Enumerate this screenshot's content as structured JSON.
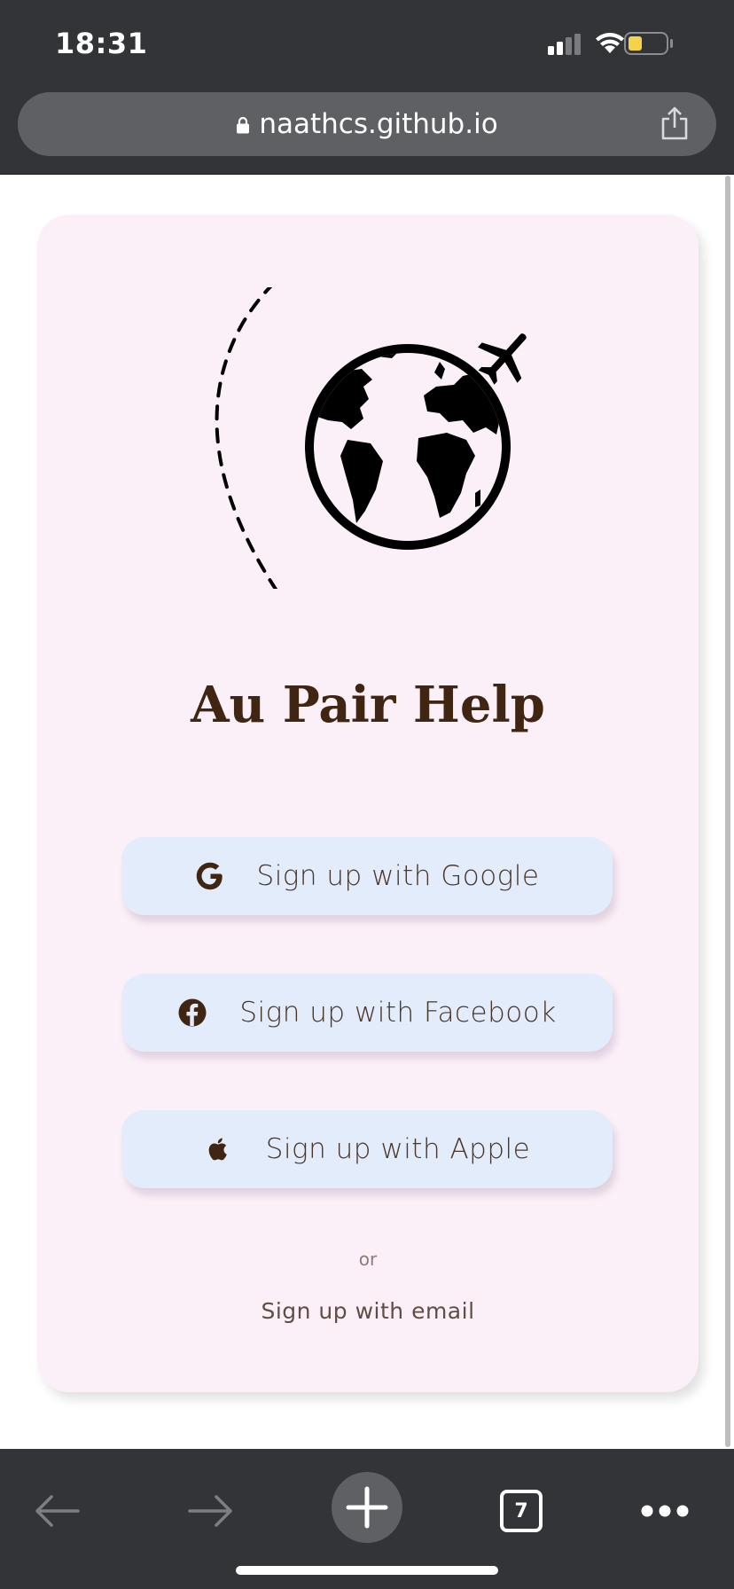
{
  "status_bar": {
    "time": "18:31",
    "signal_icon": "cellular-signal-icon",
    "wifi_icon": "wifi-icon",
    "battery_icon": "battery-icon",
    "battery_color": "#f4d24a"
  },
  "browser": {
    "url": "naathcs.github.io",
    "lock_icon": "lock-icon",
    "share_icon": "share-icon"
  },
  "card": {
    "background": "#fbf0f8",
    "illustration": "globe-with-airplane-icon",
    "title": "Au Pair Help",
    "buttons": [
      {
        "icon": "google-icon",
        "label": "Sign up with Google"
      },
      {
        "icon": "facebook-icon",
        "label": "Sign up with Facebook"
      },
      {
        "icon": "apple-icon",
        "label": "Sign up with Apple"
      }
    ],
    "separator": "or",
    "email_link": "Sign up with email"
  },
  "toolbar": {
    "back_icon": "back-arrow-icon",
    "forward_icon": "forward-arrow-icon",
    "new_tab_icon": "plus-icon",
    "tab_count": "7",
    "more_icon": "more-dots-icon"
  },
  "colors": {
    "chrome": "#333438",
    "url_bar": "#5e6064",
    "title": "#3f2512",
    "button_bg": "#e3ecfb"
  }
}
